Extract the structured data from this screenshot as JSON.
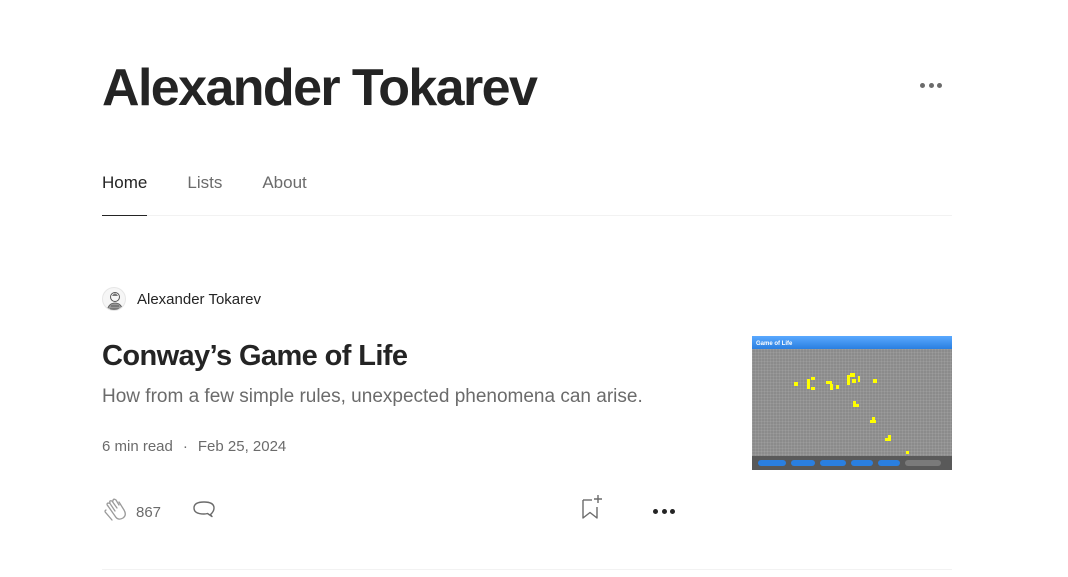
{
  "profile": {
    "name": "Alexander Tokarev",
    "more_icon": "more-horizontal-icon"
  },
  "tabs": [
    {
      "label": "Home",
      "active": true
    },
    {
      "label": "Lists",
      "active": false
    },
    {
      "label": "About",
      "active": false
    }
  ],
  "article": {
    "author": "Alexander Tokarev",
    "title": "Conway’s Game of Life",
    "subtitle": "How from a few simple rules, unexpected phenomena can arise.",
    "read_time": "6 min read",
    "separator": "·",
    "date": "Feb 25, 2024",
    "claps": "867",
    "icons": {
      "clap": "clap-icon",
      "comment": "comment-icon",
      "bookmark": "bookmark-add-icon",
      "more": "more-horizontal-icon"
    },
    "thumbnail": {
      "title": "Game of Life"
    }
  },
  "colors": {
    "text": "#242424",
    "muted": "#6b6b6b",
    "divider": "#f2f2f2",
    "cell": "#ffff00"
  }
}
